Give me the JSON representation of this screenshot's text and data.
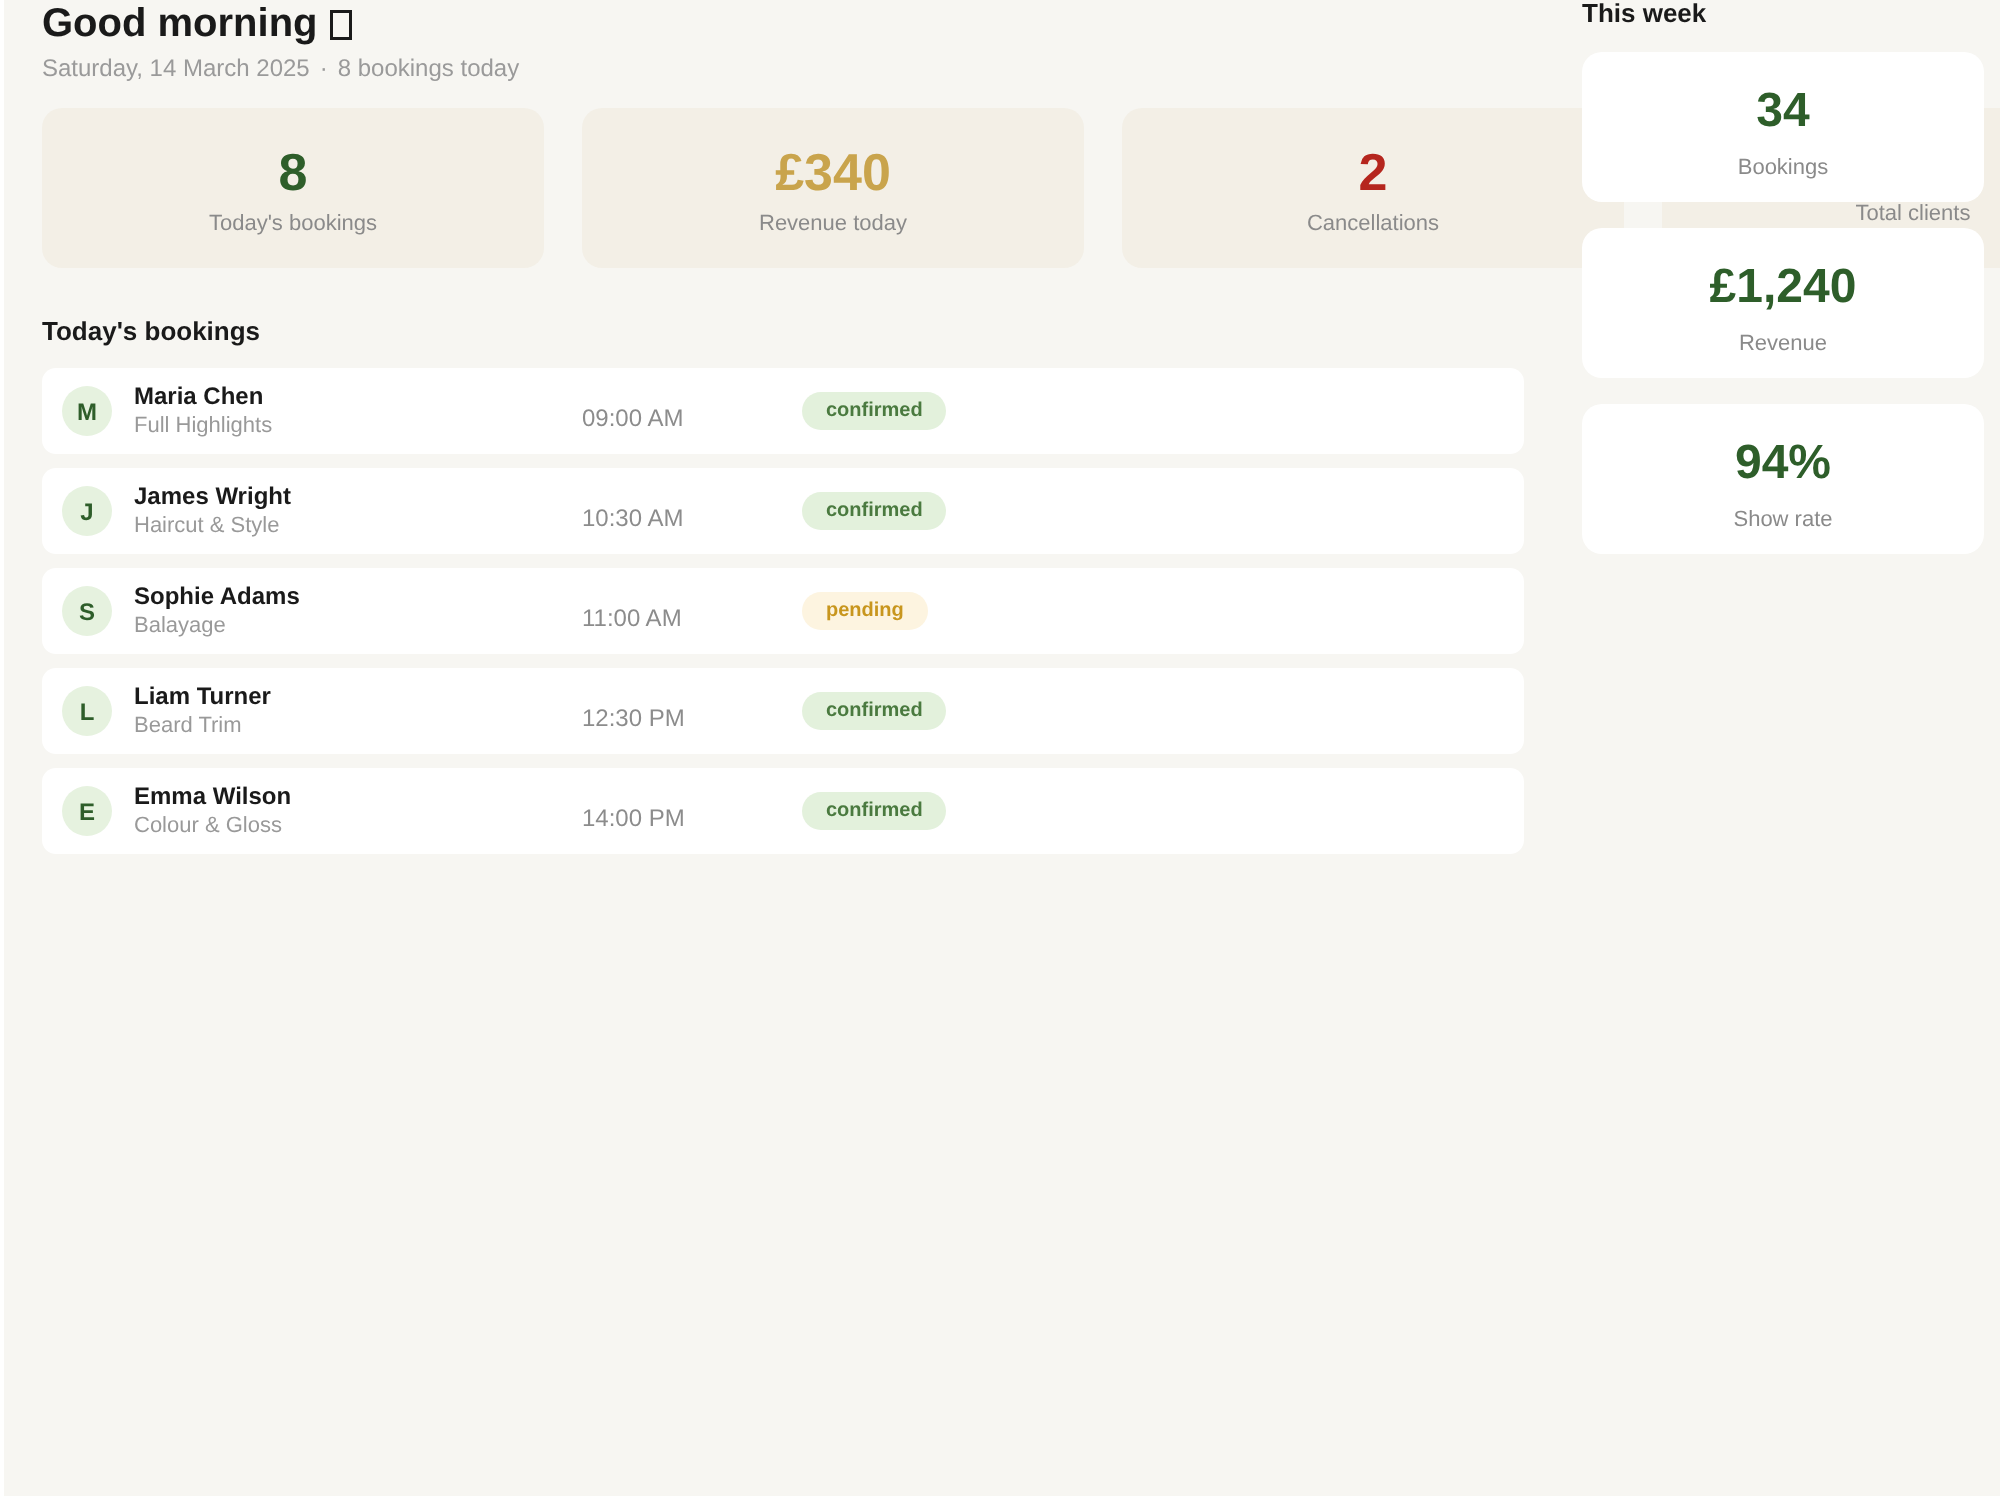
{
  "header": {
    "greeting": "Good morning",
    "date": "Saturday, 14 March 2025",
    "separator": "·",
    "summary": "8 bookings today"
  },
  "stats": [
    {
      "value": "8",
      "label": "Today's bookings",
      "color": "#2e5e2a"
    },
    {
      "value": "£340",
      "label": "Revenue today",
      "color": "#c9a44c"
    },
    {
      "value": "2",
      "label": "Cancellations",
      "color": "#b5261e"
    },
    {
      "label": "Total clients"
    }
  ],
  "bookings": {
    "title": "Today's bookings",
    "rows": [
      {
        "initial": "M",
        "name": "Maria Chen",
        "service": "Full Highlights",
        "time": "09:00 AM",
        "badge": {
          "text": "confirmed",
          "kind": "success"
        }
      },
      {
        "initial": "J",
        "name": "James Wright",
        "service": "Haircut & Style",
        "time": "10:30 AM",
        "badge": {
          "text": "confirmed",
          "kind": "success"
        }
      },
      {
        "initial": "S",
        "name": "Sophie Adams",
        "service": "Balayage",
        "time": "11:00 AM",
        "badge": {
          "text": "pending",
          "kind": "warning"
        }
      },
      {
        "initial": "L",
        "name": "Liam Turner",
        "service": "Beard Trim",
        "time": "12:30 PM",
        "badge": {
          "text": "confirmed",
          "kind": "success"
        }
      },
      {
        "initial": "E",
        "name": "Emma Wilson",
        "service": "Colour & Gloss",
        "time": "14:00 PM",
        "badge": {
          "text": "confirmed",
          "kind": "success"
        }
      }
    ]
  },
  "this_week": {
    "title": "This week",
    "cards": [
      {
        "value": "34",
        "label": "Bookings"
      },
      {
        "value": "£1,240",
        "label": "Revenue"
      },
      {
        "value": "94%",
        "label": "Show rate"
      }
    ]
  }
}
